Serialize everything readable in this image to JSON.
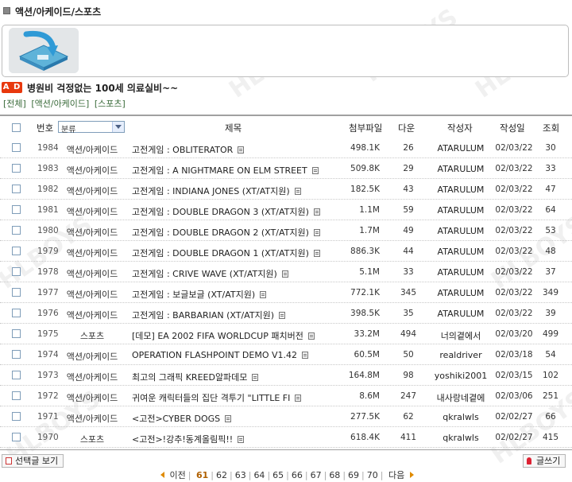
{
  "board": {
    "title": "액션/아케이드/스포츠",
    "ad_badge": "A D",
    "ad_text": "병원비 걱정없는 100세 의료실비~~",
    "breadcrumb": [
      "[전체]",
      "[액션/아케이드]",
      "[스포츠]"
    ],
    "watermark": "HLBOYS"
  },
  "table": {
    "headers": {
      "num": "번호",
      "category_select": "분류",
      "subject": "제목",
      "attach": "첨부파일",
      "download": "다운",
      "author": "작성자",
      "date": "작성일",
      "views": "조회"
    },
    "rows": [
      {
        "num": "1984",
        "category": "액션/아케이드",
        "subject": "고전게임 : OBLITERATOR",
        "size": "498.1K",
        "down": "26",
        "author": "ATARULUM",
        "date": "02/03/22",
        "views": "30"
      },
      {
        "num": "1983",
        "category": "액션/아케이드",
        "subject": "고전게임 : A NIGHTMARE ON ELM STREET",
        "size": "509.8K",
        "down": "29",
        "author": "ATARULUM",
        "date": "02/03/22",
        "views": "33"
      },
      {
        "num": "1982",
        "category": "액션/아케이드",
        "subject": "고전게임 : INDIANA JONES (XT/AT지원)",
        "size": "182.5K",
        "down": "43",
        "author": "ATARULUM",
        "date": "02/03/22",
        "views": "47"
      },
      {
        "num": "1981",
        "category": "액션/아케이드",
        "subject": "고전게임 : DOUBLE DRAGON 3 (XT/AT지원)",
        "size": "1.1M",
        "down": "59",
        "author": "ATARULUM",
        "date": "02/03/22",
        "views": "64"
      },
      {
        "num": "1980",
        "category": "액션/아케이드",
        "subject": "고전게임 : DOUBLE DRAGON 2 (XT/AT지원)",
        "size": "1.7M",
        "down": "49",
        "author": "ATARULUM",
        "date": "02/03/22",
        "views": "53"
      },
      {
        "num": "1979",
        "category": "액션/아케이드",
        "subject": "고전게임 : DOUBLE DRAGON 1 (XT/AT지원)",
        "size": "886.3K",
        "down": "44",
        "author": "ATARULUM",
        "date": "02/03/22",
        "views": "48"
      },
      {
        "num": "1978",
        "category": "액션/아케이드",
        "subject": "고전게임 : CRIVE WAVE (XT/AT지원)",
        "size": "5.1M",
        "down": "33",
        "author": "ATARULUM",
        "date": "02/03/22",
        "views": "37"
      },
      {
        "num": "1977",
        "category": "액션/아케이드",
        "subject": "고전게임 : 보글보글 (XT/AT지원)",
        "size": "772.1K",
        "down": "345",
        "author": "ATARULUM",
        "date": "02/03/22",
        "views": "349"
      },
      {
        "num": "1976",
        "category": "액션/아케이드",
        "subject": "고전게임 : BARBARIAN (XT/AT지원)",
        "size": "398.5K",
        "down": "35",
        "author": "ATARULUM",
        "date": "02/03/22",
        "views": "39"
      },
      {
        "num": "1975",
        "category": "스포츠",
        "subject": "[데모] EA 2002 FIFA WORLDCUP 패치버전",
        "size": "33.2M",
        "down": "494",
        "author": "너의곁에서",
        "date": "02/03/20",
        "views": "499"
      },
      {
        "num": "1974",
        "category": "액션/아케이드",
        "subject": "OPERATION FLASHPOINT DEMO V1.42",
        "size": "60.5M",
        "down": "50",
        "author": "realdriver",
        "date": "02/03/18",
        "views": "54"
      },
      {
        "num": "1973",
        "category": "액션/아케이드",
        "subject": "최고의 그래픽 KREED알파데모",
        "size": "164.8M",
        "down": "98",
        "author": "yoshiki2001",
        "date": "02/03/15",
        "views": "102"
      },
      {
        "num": "1972",
        "category": "액션/아케이드",
        "subject": "귀여운 캐릭터들의 집단 격투기 \"LITTLE FI",
        "size": "8.6M",
        "down": "247",
        "author": "내사랑네곁에",
        "date": "02/03/06",
        "views": "251"
      },
      {
        "num": "1971",
        "category": "액션/아케이드",
        "subject": "<고전>CYBER DOGS",
        "size": "277.5K",
        "down": "62",
        "author": "qkralwls",
        "date": "02/02/27",
        "views": "66"
      },
      {
        "num": "1970",
        "category": "스포츠",
        "subject": "<고전>!강추!동계올림픽!!",
        "size": "618.4K",
        "down": "411",
        "author": "qkralwls",
        "date": "02/02/27",
        "views": "415"
      }
    ]
  },
  "footer": {
    "select_view": "선택글 보기",
    "write": "글쓰기",
    "prev": "이전",
    "pages": [
      "61",
      "62",
      "63",
      "64",
      "65",
      "66",
      "67",
      "68",
      "69",
      "70"
    ],
    "current_page": "61",
    "next": "다음"
  }
}
